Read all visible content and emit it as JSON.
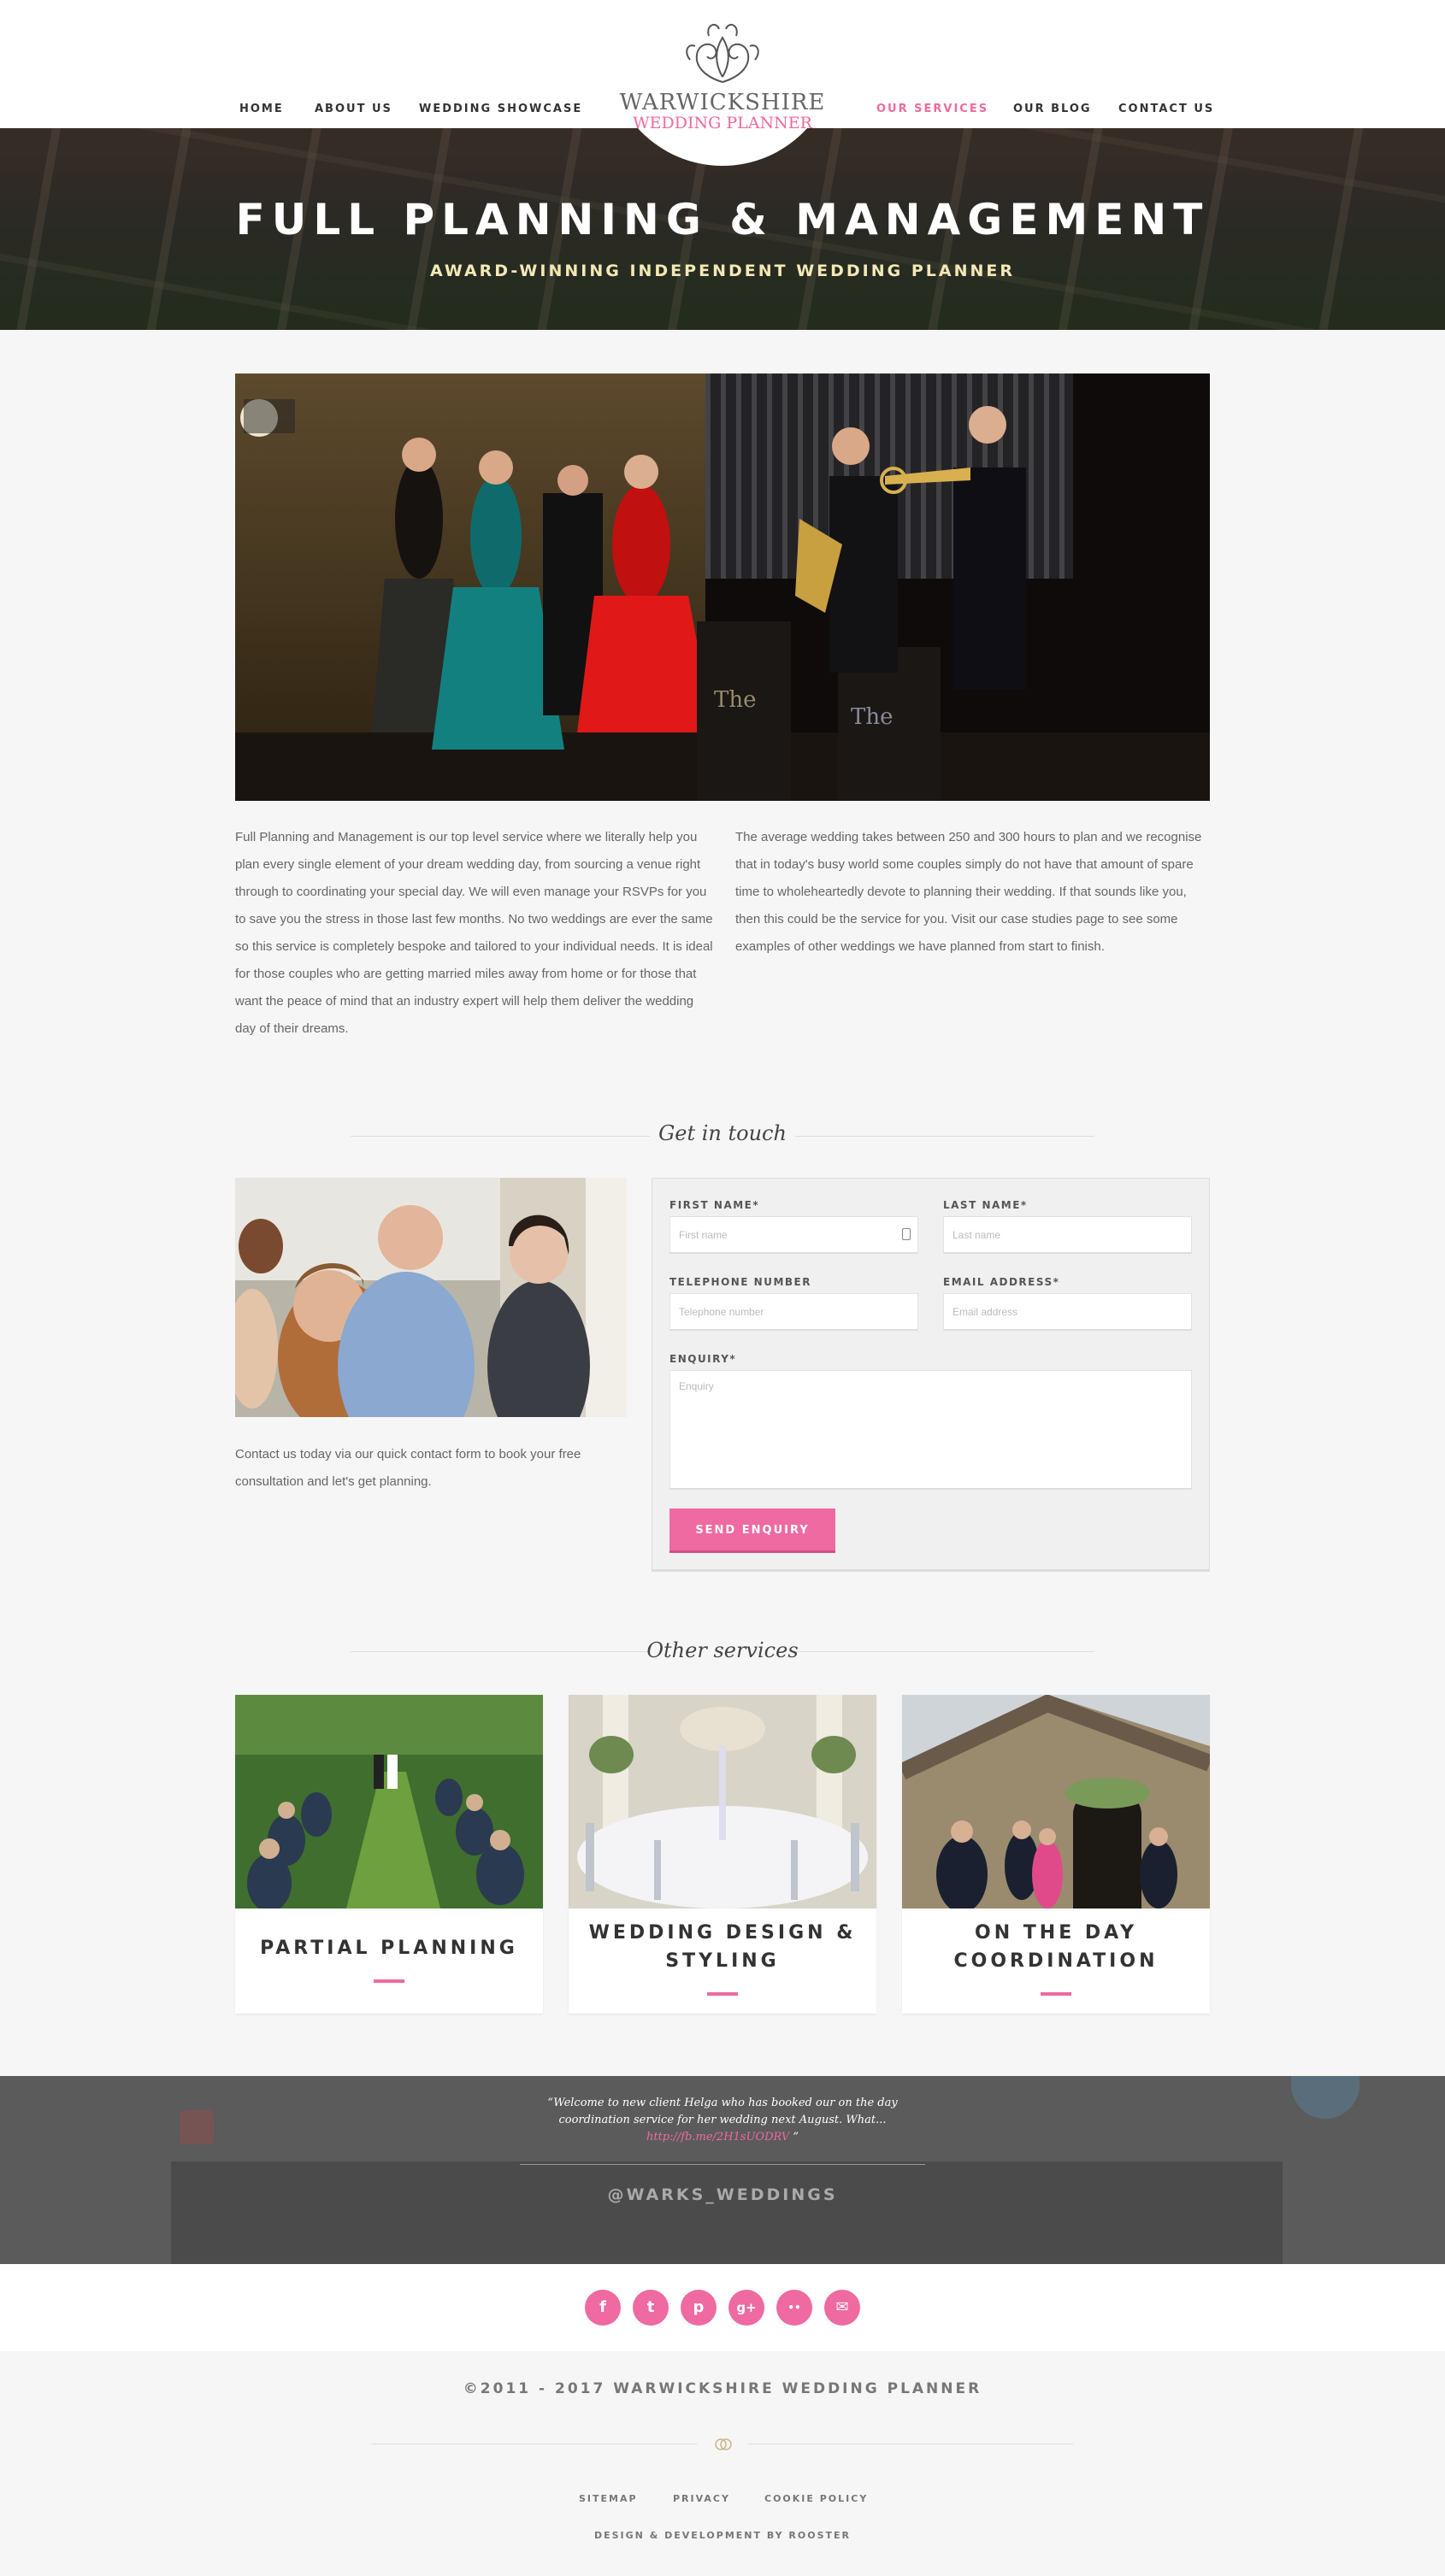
{
  "nav": {
    "home": "HOME",
    "about": "ABOUT US",
    "showcase": "WEDDING SHOWCASE",
    "services": "OUR SERVICES",
    "blog": "OUR BLOG",
    "contact": "CONTACT US"
  },
  "logo": {
    "line1": "WARWICKSHIRE",
    "line2": "WEDDING PLANNER"
  },
  "hero": {
    "title": "FULL PLANNING & MANAGEMENT",
    "subtitle": "AWARD-WINNING INDEPENDENT WEDDING PLANNER"
  },
  "intro": {
    "left": "Full Planning and Management is our top level service where we literally help you plan every single element of your dream wedding day, from sourcing a venue right through to coordinating your special day. We will even manage your RSVPs for you to save you the stress in those last few months. No two weddings are ever the same so this service is completely bespoke and tailored to your individual needs. It is ideal for those couples who are getting married miles away from home or for those that want the peace of mind that an industry expert will help them deliver the wedding day of their dreams.",
    "right": "The average wedding takes between 250 and 300 hours to plan and we recognise that in today's busy world some couples simply do not have that amount of spare time to wholeheartedly devote to planning their wedding. If that sounds like you, then this could be the service for you. Visit our case studies page to see some examples of other weddings we have planned from start to finish."
  },
  "contact": {
    "heading": "Get in touch",
    "blurb": "Contact us today via our quick contact form to book your free consultation and let's get planning.",
    "first_name_label": "FIRST NAME*",
    "first_name_placeholder": "First name",
    "last_name_label": "LAST NAME*",
    "last_name_placeholder": "Last name",
    "phone_label": "TELEPHONE NUMBER",
    "phone_placeholder": "Telephone number",
    "email_label": "EMAIL ADDRESS*",
    "email_placeholder": "Email address",
    "enquiry_label": "ENQUIRY*",
    "enquiry_placeholder": "Enquiry",
    "send_label": "SEND ENQUIRY"
  },
  "services": {
    "heading": "Other services",
    "items": [
      {
        "title": "PARTIAL PLANNING"
      },
      {
        "title": "WEDDING DESIGN & STYLING"
      },
      {
        "title": "ON THE DAY COORDINATION"
      }
    ]
  },
  "twitter": {
    "quote_open": "“",
    "quote_text": "Welcome to new client Helga who has booked our on the day coordination service for her wedding next August. What...",
    "link": "http://fb.me/2H1sUODRV",
    "quote_close": "”",
    "handle": "@WARKS_WEDDINGS"
  },
  "social": {
    "icons": [
      "facebook-icon",
      "twitter-icon",
      "pinterest-icon",
      "google-plus-icon",
      "flickr-icon",
      "email-icon"
    ],
    "glyphs": [
      "f",
      "t",
      "p",
      "g+",
      "••",
      "✉"
    ]
  },
  "footer": {
    "copyright": "©2011 - 2017 WARWICKSHIRE WEDDING PLANNER",
    "sitemap": "SITEMAP",
    "privacy": "PRIVACY",
    "cookie": "COOKIE POLICY",
    "credit": "DESIGN & DEVELOPMENT BY ROOSTER"
  },
  "colors": {
    "accent": "#ee6aa0",
    "text": "#555555",
    "background": "#f6f6f6"
  }
}
